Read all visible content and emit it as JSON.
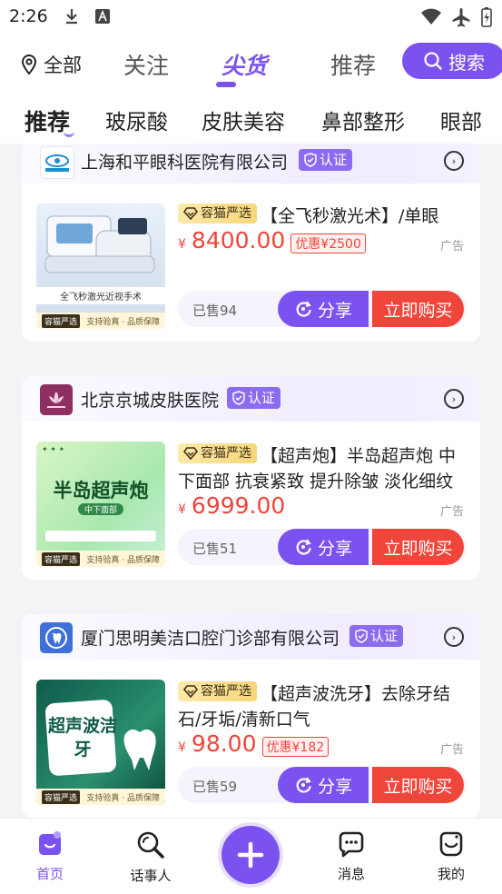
{
  "status": {
    "time": "2:26"
  },
  "topnav": {
    "location": "全部",
    "tabs": [
      {
        "label": "关注"
      },
      {
        "label": "尖货"
      },
      {
        "label": "推荐"
      }
    ],
    "search_label": "搜索"
  },
  "categories": [
    "推荐",
    "玻尿酸",
    "皮肤美容",
    "鼻部整形",
    "眼部"
  ],
  "products": [
    {
      "hospital": "上海和平眼科医院有限公司",
      "cert": "认证",
      "badge": "容猫严选",
      "title": "【全飞秒激光术】/单眼",
      "currency": "¥",
      "price": "8400.00",
      "discount": "优惠¥2500",
      "ad": "广告",
      "sold": "已售94",
      "share": "分享",
      "buy": "立即购买",
      "thumb_text": "全飞秒激光近视手术",
      "thumb_caption_left": "容猫严选",
      "thumb_caption_right": "支持验真 · 品质保障"
    },
    {
      "hospital": "北京京城皮肤医院",
      "cert": "认证",
      "badge": "容猫严选",
      "title": "【超声炮】半岛超声炮 中下面部 抗衰紧致 提升除皱 淡化细纹",
      "currency": "¥",
      "price": "6999.00",
      "discount": "",
      "ad": "广告",
      "sold": "已售51",
      "share": "分享",
      "buy": "立即购买",
      "thumb_text": "半岛超声炮",
      "thumb_sub": "中下面部",
      "thumb_caption_left": "容猫严选",
      "thumb_caption_right": "支持验真 · 品质保障"
    },
    {
      "hospital": "厦门思明美洁口腔门诊部有限公司",
      "cert": "认证",
      "badge": "容猫严选",
      "title": "【超声波洗牙】去除牙结石/牙垢/清新口气",
      "currency": "¥",
      "price": "98.00",
      "discount": "优惠¥182",
      "ad": "广告",
      "sold": "已售59",
      "share": "分享",
      "buy": "立即购买",
      "thumb_text": "超声波洁牙",
      "thumb_caption_left": "容猫严选",
      "thumb_caption_right": "支持验真 · 品质保障"
    }
  ],
  "bottom_nav": [
    {
      "label": "首页"
    },
    {
      "label": "话事人"
    },
    {
      "label": "消息"
    },
    {
      "label": "我的"
    }
  ],
  "colors": {
    "accent": "#7b52f0",
    "price": "#f0453a",
    "badge": "#f7d67a"
  }
}
